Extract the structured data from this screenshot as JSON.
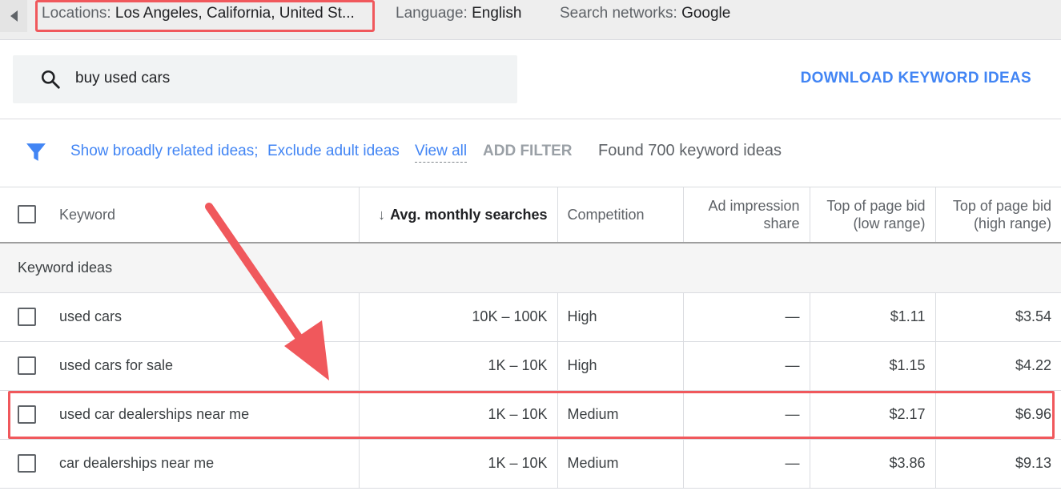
{
  "topbar": {
    "locations_label": "Locations:",
    "locations_value": "Los Angeles, California, United St...",
    "language_label": "Language:",
    "language_value": "English",
    "networks_label": "Search networks:",
    "networks_value": "Google"
  },
  "search": {
    "value": "buy used cars"
  },
  "actions": {
    "download_label": "DOWNLOAD KEYWORD IDEAS"
  },
  "filters": {
    "broad": "Show broadly related ideas;",
    "adult": "Exclude adult ideas",
    "view_all": "View all",
    "add_filter": "ADD FILTER",
    "found": "Found 700 keyword ideas"
  },
  "table": {
    "headers": {
      "keyword": "Keyword",
      "searches": "Avg. monthly searches",
      "competition": "Competition",
      "impression_1": "Ad impression",
      "impression_2": "share",
      "low_1": "Top of page bid",
      "low_2": "(low range)",
      "high_1": "Top of page bid",
      "high_2": "(high range)"
    },
    "group_label": "Keyword ideas",
    "rows": [
      {
        "keyword": "used cars",
        "searches": "10K – 100K",
        "competition": "High",
        "impression": "—",
        "low": "$1.11",
        "high": "$3.54"
      },
      {
        "keyword": "used cars for sale",
        "searches": "1K – 10K",
        "competition": "High",
        "impression": "—",
        "low": "$1.15",
        "high": "$4.22"
      },
      {
        "keyword": "used car dealerships near me",
        "searches": "1K – 10K",
        "competition": "Medium",
        "impression": "—",
        "low": "$2.17",
        "high": "$6.96"
      },
      {
        "keyword": "car dealerships near me",
        "searches": "1K – 10K",
        "competition": "Medium",
        "impression": "—",
        "low": "$3.86",
        "high": "$9.13"
      }
    ]
  },
  "colors": {
    "accent": "#4285f4",
    "highlight": "#f0585c"
  }
}
